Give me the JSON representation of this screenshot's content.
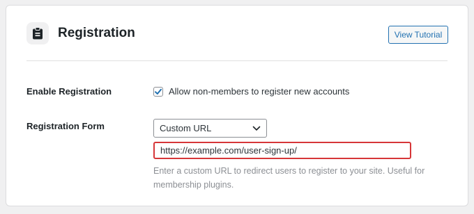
{
  "header": {
    "icon": "clipboard-icon",
    "title": "Registration",
    "tutorial_button": "View Tutorial"
  },
  "fields": {
    "enable_registration": {
      "label": "Enable Registration",
      "checked": true,
      "checkbox_label": "Allow non-members to register new accounts"
    },
    "registration_form": {
      "label": "Registration Form",
      "select_value": "Custom URL",
      "url_value": "https://example.com/user-sign-up/",
      "help": "Enter a custom URL to redirect users to register to your site. Useful for membership plugins."
    }
  },
  "colors": {
    "accent": "#2271b1",
    "error_border": "#d63638",
    "background": "#f0f0f1"
  }
}
